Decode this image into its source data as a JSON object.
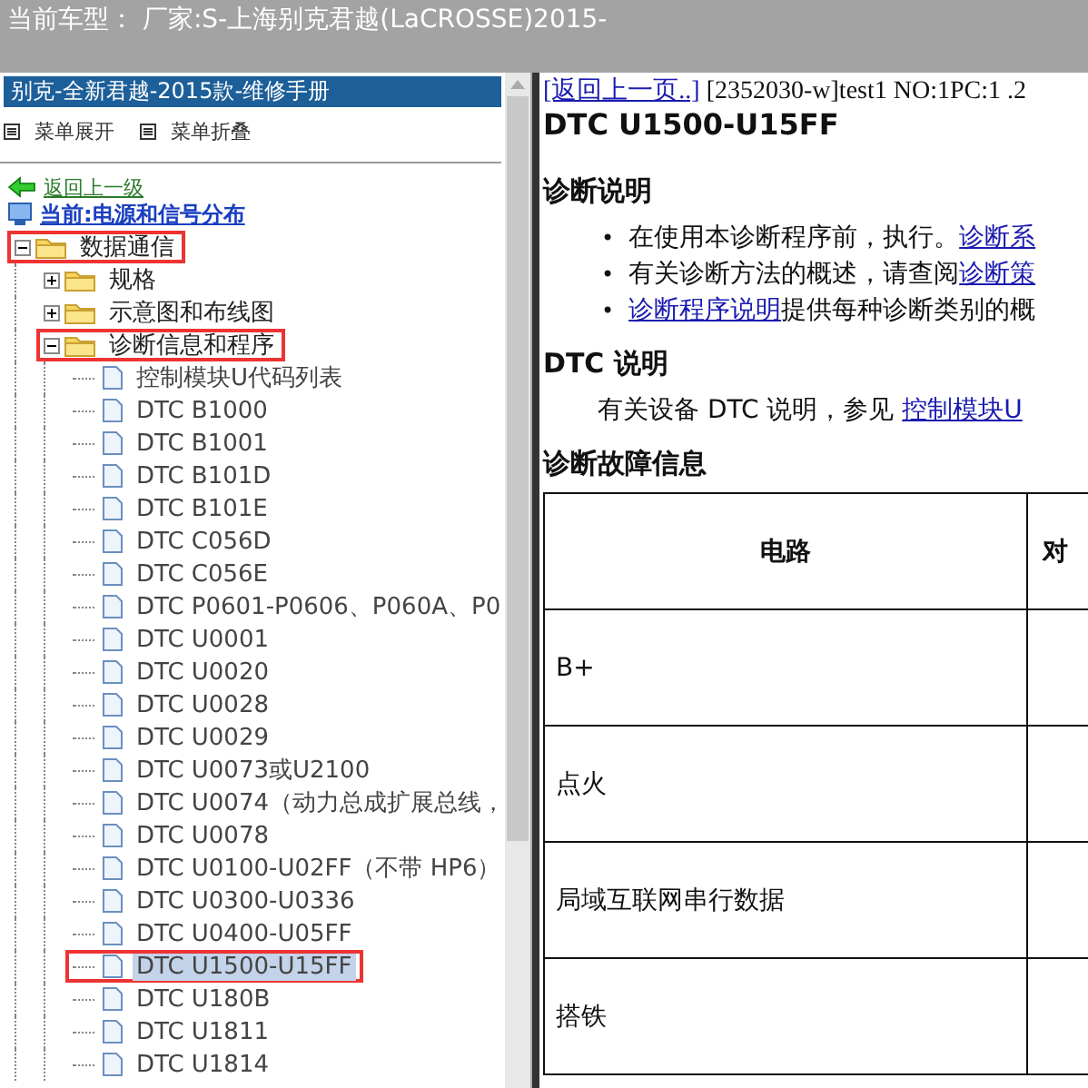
{
  "window": {
    "title": "当前车型： 厂家:S-上海别克君越(LaCROSSE)2015-"
  },
  "sidebar": {
    "title": "别克-全新君越-2015款-维修手册",
    "menu_buttons": [
      "菜单展开",
      "菜单折叠"
    ],
    "back_link": "返回上一级",
    "current": "当前:电源和信号分布",
    "tree": [
      {
        "label": "数据通信",
        "kind": "folder",
        "expanded": true,
        "selected": false,
        "marked": true,
        "children": [
          {
            "label": "规格",
            "kind": "folder",
            "expanded": false,
            "selected": false,
            "marked": false
          },
          {
            "label": "示意图和布线图",
            "kind": "folder",
            "expanded": false,
            "selected": false,
            "marked": false
          },
          {
            "label": "诊断信息和程序",
            "kind": "folder",
            "expanded": true,
            "selected": false,
            "marked": true,
            "children": [
              {
                "label": "控制模块U代码列表",
                "kind": "page",
                "selected": false,
                "marked": false
              },
              {
                "label": "DTC B1000",
                "kind": "page",
                "selected": false,
                "marked": false
              },
              {
                "label": "DTC B1001",
                "kind": "page",
                "selected": false,
                "marked": false
              },
              {
                "label": "DTC B101D",
                "kind": "page",
                "selected": false,
                "marked": false
              },
              {
                "label": "DTC B101E",
                "kind": "page",
                "selected": false,
                "marked": false
              },
              {
                "label": "DTC C056D",
                "kind": "page",
                "selected": false,
                "marked": false
              },
              {
                "label": "DTC C056E",
                "kind": "page",
                "selected": false,
                "marked": false
              },
              {
                "label": "DTC P0601-P0606、P060A、P0",
                "kind": "page",
                "selected": false,
                "marked": false
              },
              {
                "label": "DTC U0001",
                "kind": "page",
                "selected": false,
                "marked": false
              },
              {
                "label": "DTC U0020",
                "kind": "page",
                "selected": false,
                "marked": false
              },
              {
                "label": "DTC U0028",
                "kind": "page",
                "selected": false,
                "marked": false
              },
              {
                "label": "DTC U0029",
                "kind": "page",
                "selected": false,
                "marked": false
              },
              {
                "label": "DTC U0073或U2100",
                "kind": "page",
                "selected": false,
                "marked": false
              },
              {
                "label": "DTC U0074（动力总成扩展总线，",
                "kind": "page",
                "selected": false,
                "marked": false
              },
              {
                "label": "DTC U0078",
                "kind": "page",
                "selected": false,
                "marked": false
              },
              {
                "label": "DTC U0100-U02FF（不带 HP6）",
                "kind": "page",
                "selected": false,
                "marked": false
              },
              {
                "label": "DTC U0300-U0336",
                "kind": "page",
                "selected": false,
                "marked": false
              },
              {
                "label": "DTC U0400-U05FF",
                "kind": "page",
                "selected": false,
                "marked": false
              },
              {
                "label": "DTC U1500-U15FF",
                "kind": "page",
                "selected": true,
                "marked": true
              },
              {
                "label": "DTC U180B",
                "kind": "page",
                "selected": false,
                "marked": false
              },
              {
                "label": "DTC U1811",
                "kind": "page",
                "selected": false,
                "marked": false
              },
              {
                "label": "DTC U1814",
                "kind": "page",
                "selected": false,
                "marked": false
              }
            ]
          }
        ]
      }
    ]
  },
  "content": {
    "back_link": "[返回上一页..]",
    "meta": "[2352030-w]test1 NO:1PC:1 .2",
    "title": "DTC U1500-U15FF",
    "sections": [
      {
        "kind": "bullets",
        "heading": "诊断说明",
        "items": [
          {
            "marker": "•",
            "parts": [
              {
                "text": "在使用本诊断程序前，执行。",
                "kind": "text"
              },
              {
                "text": "诊断系",
                "kind": "link"
              }
            ]
          },
          {
            "marker": "•",
            "parts": [
              {
                "text": "有关诊断方法的概述，请查阅",
                "kind": "text"
              },
              {
                "text": "诊断策",
                "kind": "link"
              }
            ]
          },
          {
            "marker": "•",
            "parts": [
              {
                "text": "诊断程序说明",
                "kind": "link"
              },
              {
                "text": "提供每种诊断类别的概",
                "kind": "text"
              }
            ]
          }
        ]
      },
      {
        "kind": "paragraph",
        "heading": "DTC 说明",
        "parts": [
          {
            "text": "有关设备 DTC 说明，参见 ",
            "kind": "text"
          },
          {
            "text": "控制模块U",
            "kind": "link"
          }
        ]
      },
      {
        "kind": "table",
        "heading": "诊断故障信息",
        "columns": [
          "电路",
          "对"
        ],
        "rows": [
          [
            "B+"
          ],
          [
            "点火"
          ],
          [
            "局域互联网串行数据"
          ],
          [
            "搭铁"
          ]
        ]
      }
    ]
  }
}
